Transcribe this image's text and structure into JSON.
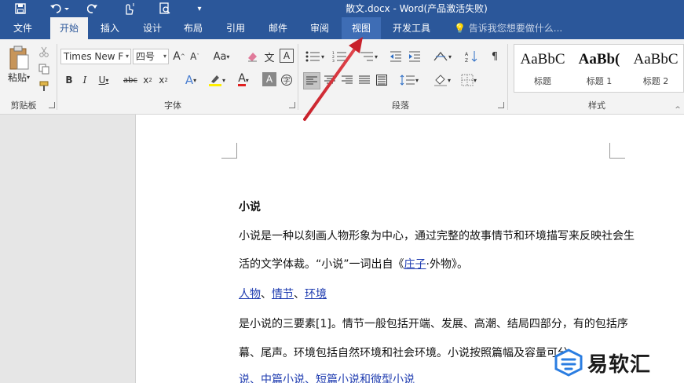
{
  "titlebar": {
    "title": "散文.docx - Word(产品激活失败)",
    "quick_access": [
      "save-icon",
      "undo-icon",
      "redo-icon",
      "touch-mode-icon",
      "print-preview-icon",
      "customize-icon"
    ]
  },
  "tabs": [
    {
      "label": "文件"
    },
    {
      "label": "开始"
    },
    {
      "label": "插入"
    },
    {
      "label": "设计"
    },
    {
      "label": "布局"
    },
    {
      "label": "引用"
    },
    {
      "label": "邮件"
    },
    {
      "label": "审阅"
    },
    {
      "label": "视图"
    },
    {
      "label": "开发工具"
    }
  ],
  "tell_me": "告诉我您想要做什么...",
  "ribbon": {
    "clipboard": {
      "paste_label": "粘贴",
      "group_label": "剪贴板"
    },
    "font": {
      "font_name": "Times New F",
      "font_size": "四号",
      "group_label": "字体"
    },
    "paragraph": {
      "group_label": "段落"
    },
    "styles": {
      "group_label": "样式",
      "items": [
        {
          "sample": "AaBbC",
          "name": "标题"
        },
        {
          "sample": "AaBb(",
          "name": "标题 1"
        },
        {
          "sample": "AaBbC",
          "name": "标题 2"
        }
      ]
    }
  },
  "document": {
    "heading": "小说",
    "p1_line1": "小说是一种以刻画人物形象为中心，通过完整的故事情节和环境描写来反映社会生",
    "p1_line2_a": "活的文学体裁。“小说”一词出自《",
    "p1_line2_link": "庄子",
    "p1_line2_b": "·外物》。",
    "links": [
      "人物",
      "情节",
      "环境"
    ],
    "sep": "、",
    "p2_line1": "是小说的三要素[1]。情节一般包括开端、发展、高潮、结局四部分，有的包括序",
    "p2_line2": "幕、尾声。环境包括自然环境和社会环境。小说按照篇幅及容量可分",
    "p3_line1": "说、中篇小说、短篇小说和微型小说"
  },
  "watermark": {
    "text": "易软汇"
  },
  "colors": {
    "brand": "#2b579a",
    "annotation_arrow": "#c8202a",
    "link": "#1f3cb0"
  }
}
